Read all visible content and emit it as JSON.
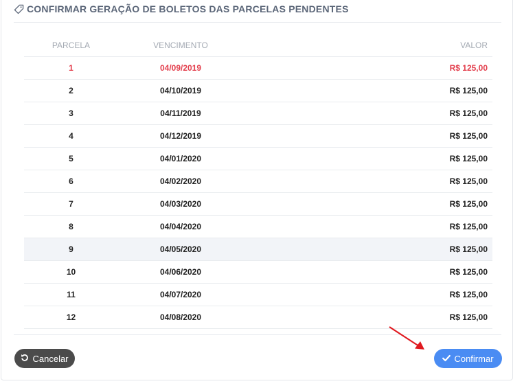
{
  "modal": {
    "title": "CONFIRMAR GERAÇÃO DE BOLETOS DAS PARCELAS PENDENTES",
    "title_icon": "tag-icon"
  },
  "table": {
    "headers": {
      "parcela": "PARCELA",
      "vencimento": "VENCIMENTO",
      "valor": "VALOR"
    },
    "rows": [
      {
        "parcela": "1",
        "vencimento": "04/09/2019",
        "valor": "R$ 125,00",
        "overdue": true
      },
      {
        "parcela": "2",
        "vencimento": "04/10/2019",
        "valor": "R$ 125,00"
      },
      {
        "parcela": "3",
        "vencimento": "04/11/2019",
        "valor": "R$ 125,00"
      },
      {
        "parcela": "4",
        "vencimento": "04/12/2019",
        "valor": "R$ 125,00"
      },
      {
        "parcela": "5",
        "vencimento": "04/01/2020",
        "valor": "R$ 125,00"
      },
      {
        "parcela": "6",
        "vencimento": "04/02/2020",
        "valor": "R$ 125,00"
      },
      {
        "parcela": "7",
        "vencimento": "04/03/2020",
        "valor": "R$ 125,00"
      },
      {
        "parcela": "8",
        "vencimento": "04/04/2020",
        "valor": "R$ 125,00"
      },
      {
        "parcela": "9",
        "vencimento": "04/05/2020",
        "valor": "R$ 125,00",
        "highlighted": true
      },
      {
        "parcela": "10",
        "vencimento": "04/06/2020",
        "valor": "R$ 125,00"
      },
      {
        "parcela": "11",
        "vencimento": "04/07/2020",
        "valor": "R$ 125,00"
      },
      {
        "parcela": "12",
        "vencimento": "04/08/2020",
        "valor": "R$ 125,00"
      }
    ]
  },
  "footer": {
    "cancel_label": "Cancelar",
    "cancel_icon": "undo-icon",
    "confirm_label": "Confirmar",
    "confirm_icon": "check-icon"
  },
  "annotation": {
    "arrow_icon": "red-arrow-icon",
    "color": "#e0191f"
  },
  "colors": {
    "overdue": "#e3414f",
    "confirm": "#4a8cf3",
    "cancel": "#4b4b4b",
    "title": "#5b6678"
  }
}
